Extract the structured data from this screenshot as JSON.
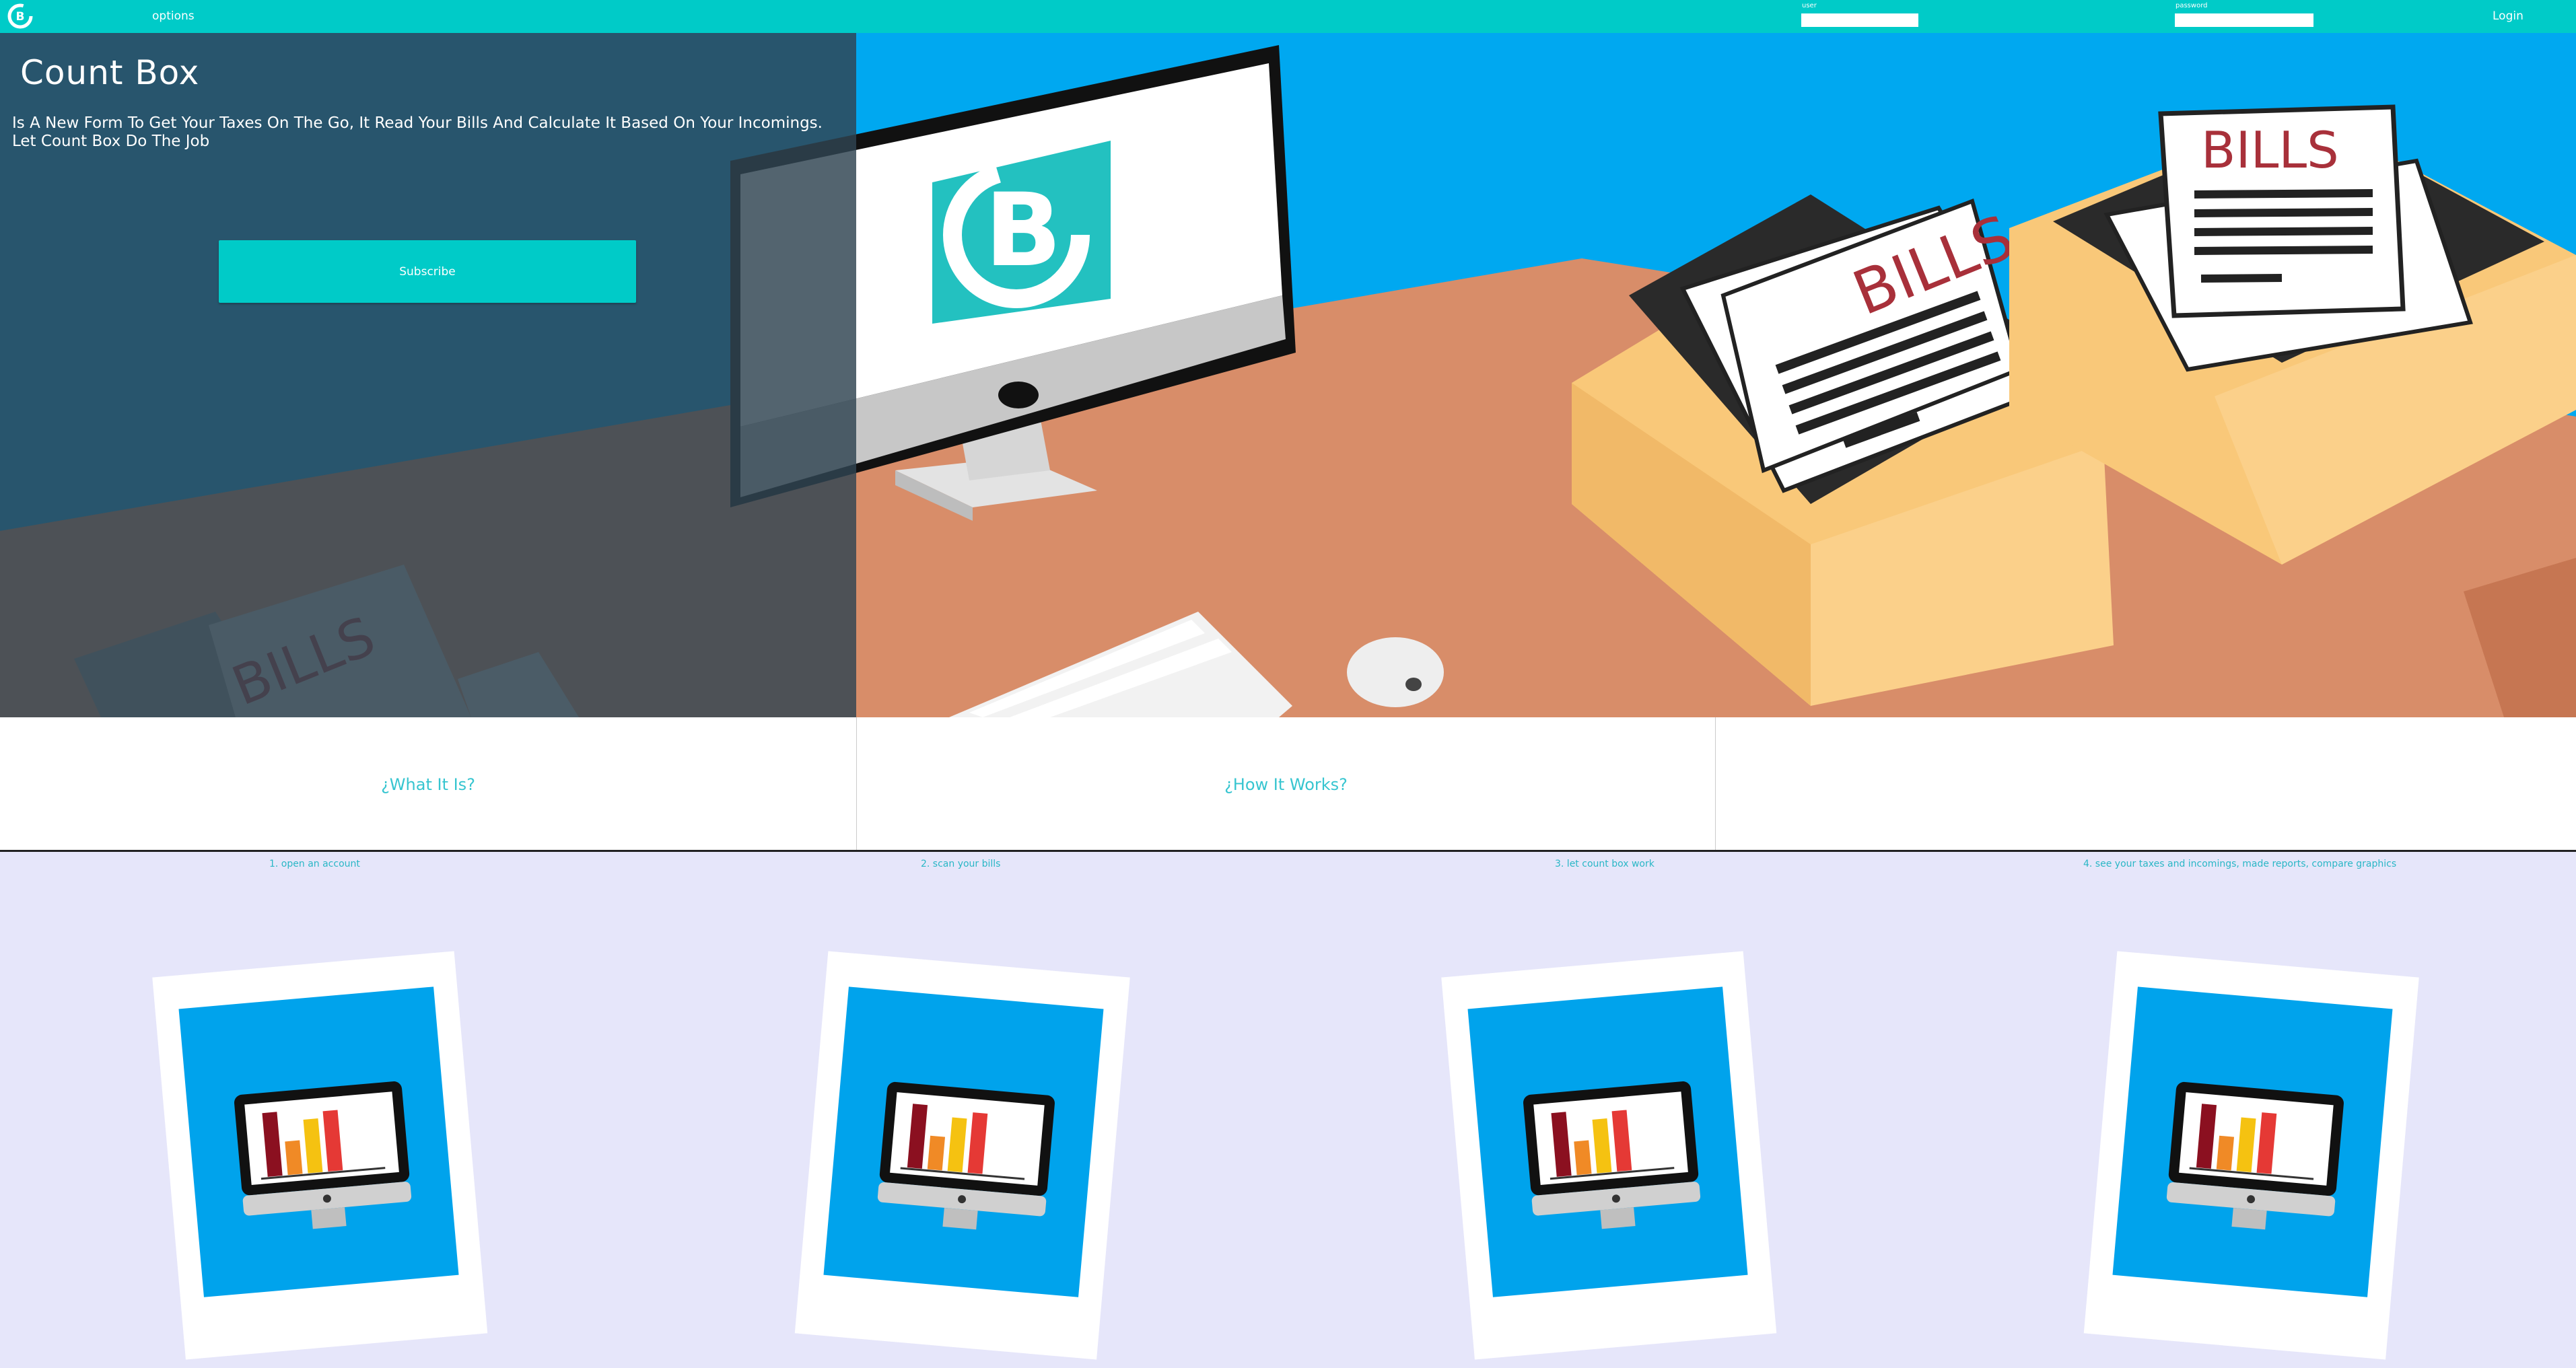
{
  "nav": {
    "options_label": "options",
    "user_label": "user",
    "user_value": "",
    "password_label": "password",
    "password_value": "",
    "login_label": "Login"
  },
  "hero": {
    "title": "Count Box",
    "description": "Is A New Form To Get Your Taxes On The Go, It Read Your Bills And Calculate It Based On Your Incomings. Let Count Box Do The Job",
    "subscribe_label": "Subscribe",
    "bills_text": "BILLS"
  },
  "info": {
    "what_label": "¿What It Is?",
    "how_label": "¿How It Works?",
    "third_label": ""
  },
  "steps": [
    {
      "label": "1. open an account"
    },
    {
      "label": "2. scan your bills"
    },
    {
      "label": "3. let count box work"
    },
    {
      "label": "4. see your taxes and incomings, made reports, compare graphics"
    }
  ],
  "colors": {
    "accent": "#00cbc8",
    "sky": "#00a8f0",
    "desk": "#d88d69",
    "steps_bg": "#e6e6fa",
    "bills_red": "#a8303a"
  },
  "icons": {
    "logo": "count-box-logo-icon",
    "step_card": "monitor-chart-icon"
  }
}
